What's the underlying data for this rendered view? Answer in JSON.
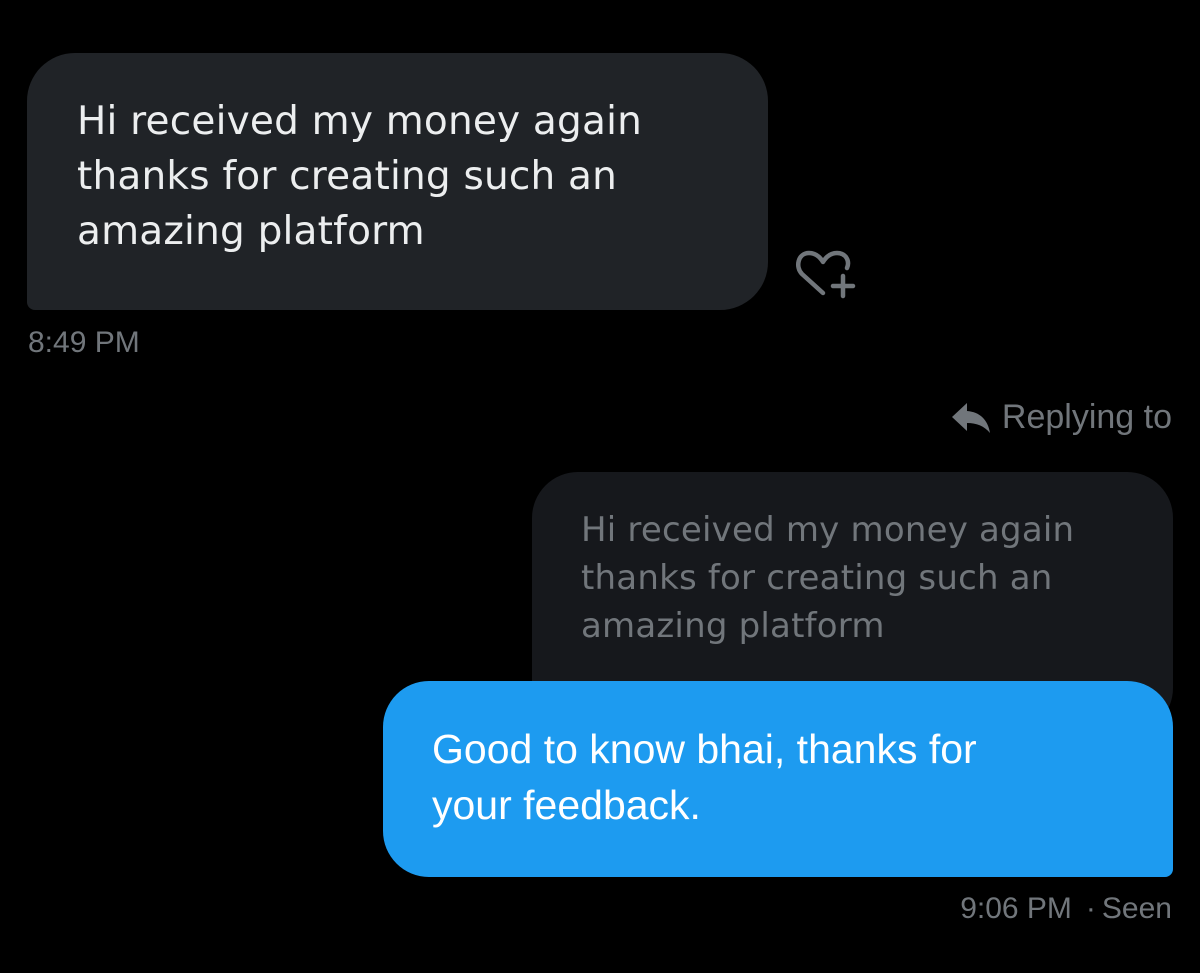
{
  "messages": {
    "incoming": {
      "text": "Hi received my money again\nthanks for creating such an\namazing platform",
      "time": "8:49 PM",
      "reaction_icon": "heart-plus-icon"
    },
    "reply": {
      "replying_label": "Replying to",
      "reply_icon": "reply-arrow-icon",
      "quoted_text": "Hi received my money again\nthanks for creating such an\namazing platform",
      "text": "Good to know bhai, thanks for\nyour feedback.",
      "time": "9:06 PM",
      "separator": "·",
      "status": "Seen"
    }
  },
  "colors": {
    "background": "#000000",
    "incoming_bubble": "#202327",
    "quoted_bubble": "#16181c",
    "outgoing_bubble": "#1d9bf0",
    "muted_text": "#71767b"
  }
}
